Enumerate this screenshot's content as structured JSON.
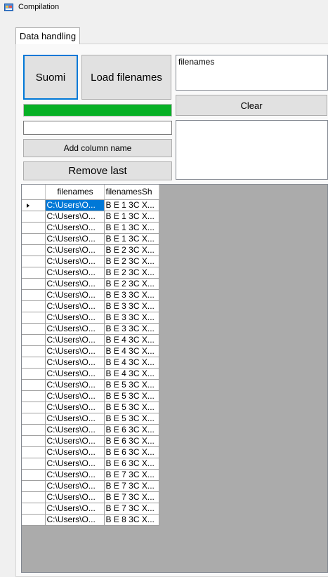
{
  "window": {
    "title": "Compilation"
  },
  "tabs": [
    {
      "label": "Data handling"
    }
  ],
  "buttons": {
    "suomi": "Suomi",
    "load_filenames": "Load filenames",
    "clear": "Clear",
    "add_column_name": "Add column name",
    "remove_last": "Remove last"
  },
  "filenames_listbox": {
    "items": [
      "filenames"
    ]
  },
  "column_name_input": {
    "value": ""
  },
  "progress": {
    "percent": 100,
    "color": "#06b025"
  },
  "grid": {
    "columns": [
      "filenames",
      "filenamesSh"
    ],
    "selected_row": 0,
    "rows": [
      [
        "C:\\Users\\O...",
        "B E 1 3C X..."
      ],
      [
        "C:\\Users\\O...",
        "B E 1 3C X..."
      ],
      [
        "C:\\Users\\O...",
        "B E 1 3C X..."
      ],
      [
        "C:\\Users\\O...",
        "B E 1 3C X..."
      ],
      [
        "C:\\Users\\O...",
        "B E 2 3C X..."
      ],
      [
        "C:\\Users\\O...",
        "B E 2 3C X..."
      ],
      [
        "C:\\Users\\O...",
        "B E 2 3C X..."
      ],
      [
        "C:\\Users\\O...",
        "B E 2 3C X..."
      ],
      [
        "C:\\Users\\O...",
        "B E 3 3C X..."
      ],
      [
        "C:\\Users\\O...",
        "B E 3 3C X..."
      ],
      [
        "C:\\Users\\O...",
        "B E 3 3C X..."
      ],
      [
        "C:\\Users\\O...",
        "B E 3 3C X..."
      ],
      [
        "C:\\Users\\O...",
        "B E 4 3C X..."
      ],
      [
        "C:\\Users\\O...",
        "B E 4 3C X..."
      ],
      [
        "C:\\Users\\O...",
        "B E 4 3C X..."
      ],
      [
        "C:\\Users\\O...",
        "B E 4 3C X..."
      ],
      [
        "C:\\Users\\O...",
        "B E 5 3C X..."
      ],
      [
        "C:\\Users\\O...",
        "B E 5 3C X..."
      ],
      [
        "C:\\Users\\O...",
        "B E 5 3C X..."
      ],
      [
        "C:\\Users\\O...",
        "B E 5 3C X..."
      ],
      [
        "C:\\Users\\O...",
        "B E 6 3C X..."
      ],
      [
        "C:\\Users\\O...",
        "B E 6 3C X..."
      ],
      [
        "C:\\Users\\O...",
        "B E 6 3C X..."
      ],
      [
        "C:\\Users\\O...",
        "B E 6 3C X..."
      ],
      [
        "C:\\Users\\O...",
        "B E 7 3C X..."
      ],
      [
        "C:\\Users\\O...",
        "B E 7 3C X..."
      ],
      [
        "C:\\Users\\O...",
        "B E 7 3C X..."
      ],
      [
        "C:\\Users\\O...",
        "B E 7 3C X..."
      ],
      [
        "C:\\Users\\O...",
        "B E 8 3C X..."
      ]
    ]
  }
}
